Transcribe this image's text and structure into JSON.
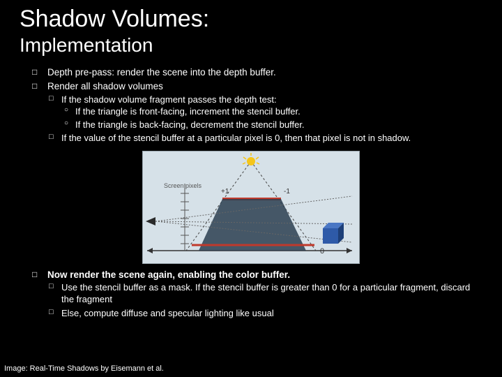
{
  "title": "Shadow Volumes:",
  "subtitle": "Implementation",
  "bullets": {
    "b1": "Depth pre-pass: render the scene into the depth buffer.",
    "b2": "Render all shadow volumes",
    "b2_1": "If the shadow volume fragment passes the depth test:",
    "b2_1_a": "If the triangle is front-facing, increment the stencil buffer.",
    "b2_1_b": "If the triangle is back-facing, decrement the stencil buffer.",
    "b2_2": "If the value of the stencil buffer at a particular pixel is 0, then that pixel is not in shadow.",
    "b3": "Now render the scene again, enabling the color buffer.",
    "b3_1": "Use the stencil buffer as a mask. If the stencil buffer is greater than 0 for a particular fragment, discard the fragment",
    "b3_2": "Else, compute diffuse and specular lighting like usual"
  },
  "diagram": {
    "screen_pixels_label": "Screen pixels",
    "plus1": "+1",
    "minus1": "-1",
    "zero": "0"
  },
  "credit": "Image: Real-Time Shadows by Eisemann et al."
}
